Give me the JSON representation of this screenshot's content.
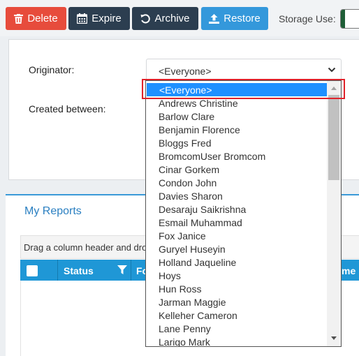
{
  "toolbar": {
    "delete_label": "Delete",
    "expire_label": "Expire",
    "archive_label": "Archive",
    "restore_label": "Restore",
    "storage_label": "Storage Use:",
    "storage_fill_fraction": 0.15,
    "colors": {
      "delete": "#e74c3c",
      "dark": "#2c3e50",
      "restore": "#3498db",
      "storage": "#1e5e36"
    }
  },
  "filters": {
    "originator_label": "Originator:",
    "originator_value": "<Everyone>",
    "created_between_label": "Created between:"
  },
  "reports": {
    "title": "My Reports",
    "grid_hint": "Drag a column header and dro",
    "columns": [
      "Status",
      "Fo",
      "me"
    ]
  },
  "dropdown": {
    "selected": "<Everyone>",
    "options": [
      "Andrews Christine",
      "Barlow Clare",
      "Benjamin Florence",
      "Bloggs Fred",
      "BromcomUser Bromcom",
      "Cinar Gorkem",
      "Condon John",
      "Davies Sharon",
      "Desaraju Saikrishna",
      "Esmail Muhammad",
      "Fox Janice",
      "Guryel Huseyin",
      "Holland Jaqueline",
      "Hoys",
      "Hun Ross",
      "Jarman Maggie",
      "Kelleher Cameron",
      "Lane Penny",
      "Larigo Mark"
    ]
  },
  "icons": {
    "delete": "trash-icon",
    "expire": "calendar-icon",
    "archive": "undo-icon",
    "restore": "upload-icon",
    "select": "chevron-down-icon",
    "status_filter": "filter-icon"
  }
}
